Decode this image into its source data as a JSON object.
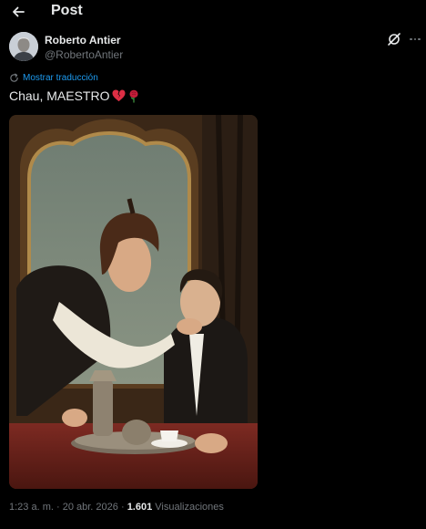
{
  "header": {
    "title": "Post"
  },
  "author": {
    "display_name": "Roberto Antier",
    "handle": "@RobertoAntier"
  },
  "translate": {
    "label": "Mostrar traducción"
  },
  "tweet": {
    "text": "Chau, MAESTRO"
  },
  "icons": {
    "back": "arrow-left-icon",
    "grok": "grok-icon",
    "more": "more-icon",
    "translate": "translate-icon",
    "emoji_1": "broken-heart-emoji",
    "emoji_2": "rose-emoji"
  },
  "footer": {
    "time": "1:23 a. m.",
    "sep1": "·",
    "date": "20 abr. 2026",
    "sep2": "·",
    "views_count": "1.601",
    "views_label": "Visualizaciones"
  },
  "colors": {
    "accent": "#1d9bf0",
    "muted": "#71767b",
    "text": "#e7e9ea",
    "background": "#000000"
  }
}
